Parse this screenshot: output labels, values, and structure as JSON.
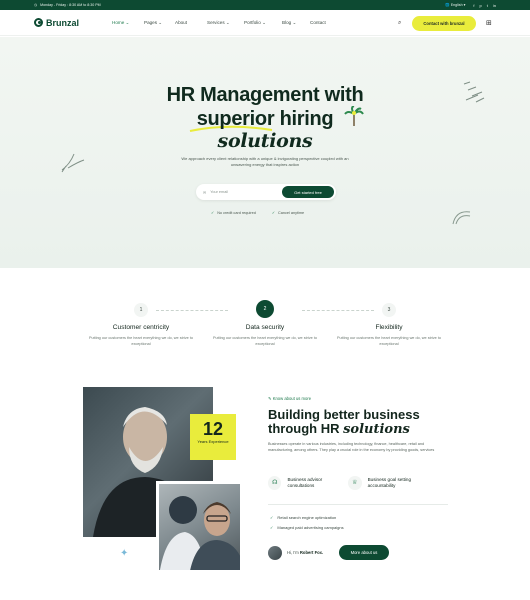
{
  "topbar": {
    "schedule": "Monday - Friday : 8:30 AM to 8:30 PM",
    "language": "English",
    "social": [
      "f",
      "p",
      "t",
      "in"
    ]
  },
  "nav": {
    "logo": "Brunzal",
    "menu": [
      "Home",
      "Pages",
      "About",
      "Services",
      "Portfolio",
      "Blog",
      "Contact"
    ],
    "cta": "Contact with brunzal"
  },
  "hero": {
    "line1": "HR Management with",
    "line2": "superior hiring",
    "line3": "solutions",
    "sub": "We approach every client relationship with a unique & invigorating perspective coupled with an unwavering energy that inspires action",
    "email_placeholder": "Your email",
    "button": "Get started free",
    "check1": "No credit card required",
    "check2": "Cancel anytime"
  },
  "features": [
    {
      "num": "1",
      "title": "Customer centricity",
      "desc": "Putting our customers the heart everything we do, we strive to exceptional"
    },
    {
      "num": "2",
      "title": "Data security",
      "desc": "Putting our customers the heart everything we do, we strive to exceptional"
    },
    {
      "num": "3",
      "title": "Flexibility",
      "desc": "Putting our customers the heart everything we do, we strive to exceptional"
    }
  ],
  "about": {
    "badge_num": "12",
    "badge_label": "Years Experience",
    "tag": "Know about us more",
    "title1": "Building better business",
    "title2a": "through HR ",
    "title2b": "solutions",
    "para": "Businesses operate in various industries, including technology, finance, healthcare, retail and manufacturing, among others. They play a crucial role in the economy by providing goods, services",
    "svc1": "Business advisor consultations",
    "svc2": "Business goal setting accountability",
    "list1": "Retail search engine optimization",
    "list2": "Managed paid advertising campaigns",
    "hi_prefix": "Hi, I'm",
    "hi_name": "Robert Fox.",
    "more": "More about us"
  },
  "colors": {
    "brand": "#0d4a32",
    "accent": "#e9ec3c"
  }
}
